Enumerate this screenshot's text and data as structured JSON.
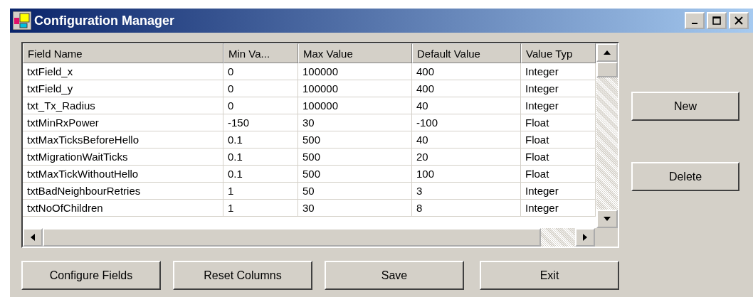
{
  "window": {
    "title": "Configuration Manager"
  },
  "table": {
    "columns": [
      "Field Name",
      "Min Va...",
      "Max Value",
      "Default Value",
      "Value Typ"
    ],
    "rows": [
      [
        "txtField_x",
        "0",
        "100000",
        "400",
        "Integer"
      ],
      [
        "txtField_y",
        "0",
        "100000",
        "400",
        "Integer"
      ],
      [
        "txt_Tx_Radius",
        "0",
        "100000",
        "40",
        "Integer"
      ],
      [
        "txtMinRxPower",
        "-150",
        "30",
        "-100",
        "Float"
      ],
      [
        "txtMaxTicksBeforeHello",
        "0.1",
        "500",
        "40",
        "Float"
      ],
      [
        "txtMigrationWaitTicks",
        "0.1",
        "500",
        "20",
        "Float"
      ],
      [
        "txtMaxTickWithoutHello",
        "0.1",
        "500",
        "100",
        "Float"
      ],
      [
        "txtBadNeighbourRetries",
        "1",
        "50",
        "3",
        "Integer"
      ],
      [
        "txtNoOfChildren",
        "1",
        "30",
        "8",
        "Integer"
      ]
    ]
  },
  "side_buttons": [
    "New",
    "Delete"
  ],
  "bottom_buttons": [
    "Configure Fields",
    "Reset Columns",
    "Save",
    "Exit"
  ]
}
